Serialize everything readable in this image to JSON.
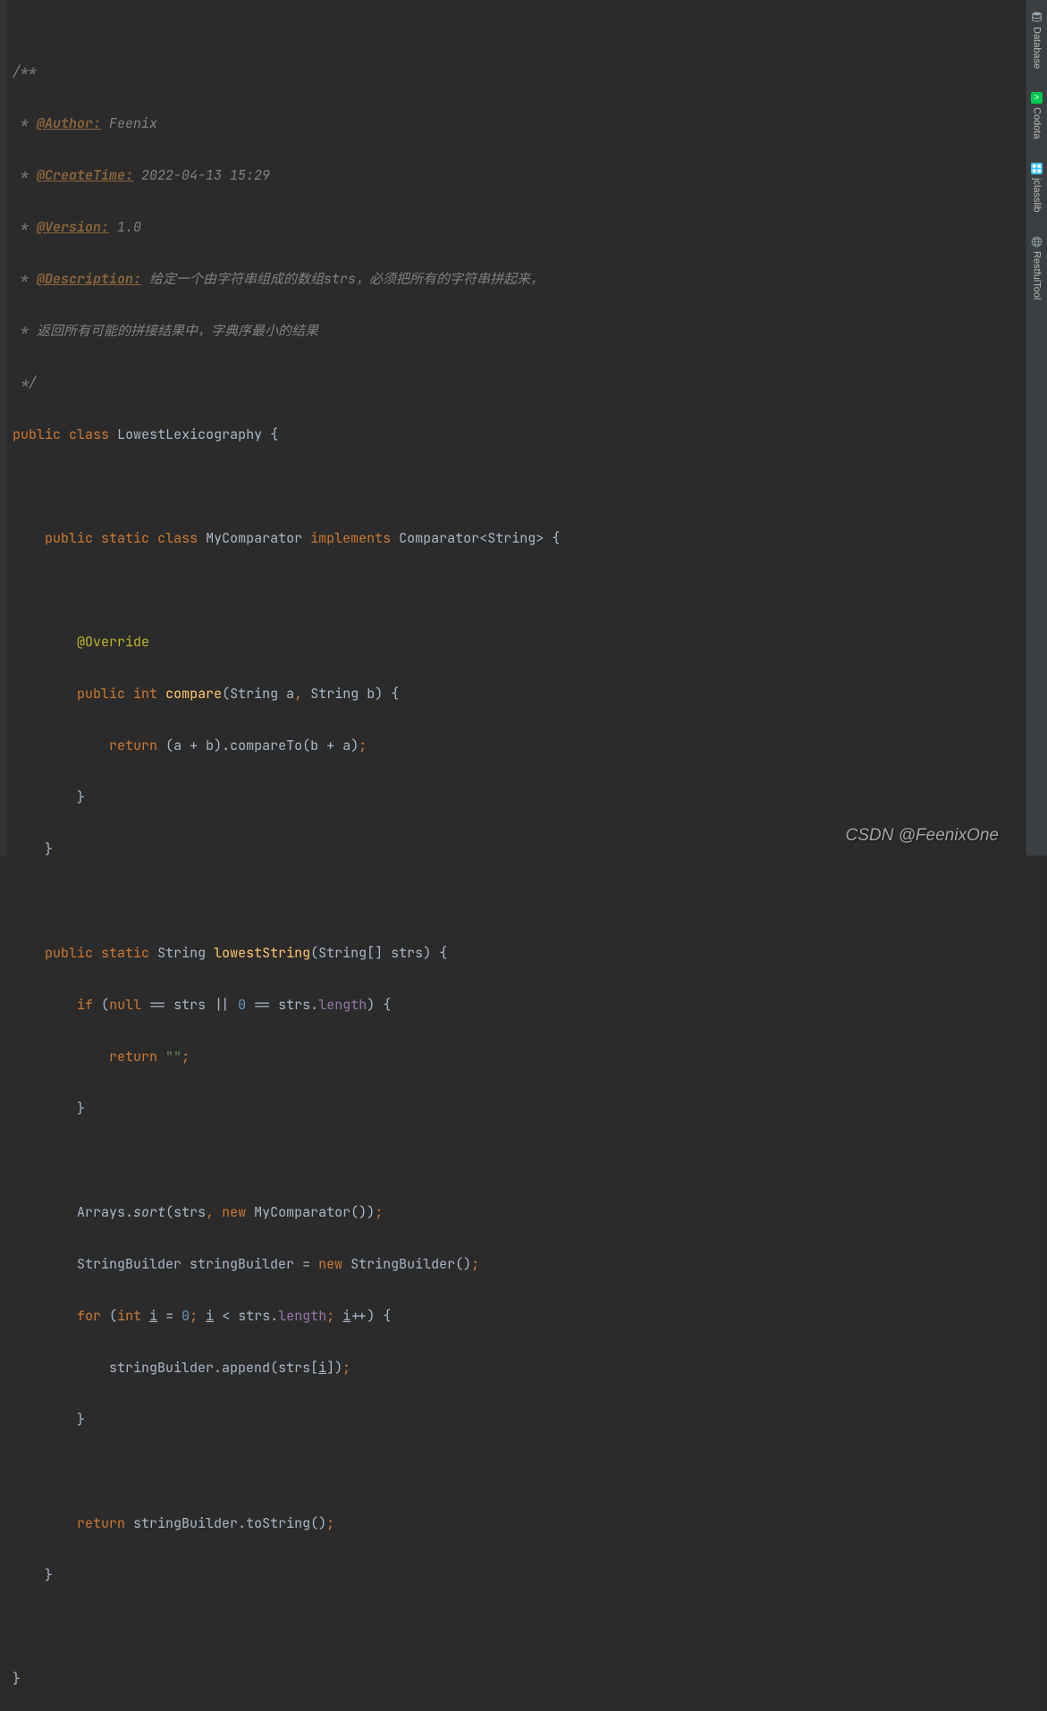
{
  "doc": {
    "author_tag": "@Author:",
    "author": " Feenix",
    "createtime_tag": "@CreateTime:",
    "createtime": " 2022-04-13 15:29",
    "version_tag": "@Version:",
    "version": " 1.0",
    "description_tag": "@Description:",
    "description": " 给定一个由字符串组成的数组strs，必须把所有的字符串拼起来，",
    "description2": " * 返回所有可能的拼接结果中，字典序最小的结果"
  },
  "code": {
    "public": "public",
    "class": "class",
    "static": "static",
    "implements": "implements",
    "int": "int",
    "return": "return",
    "if": "if",
    "null": "null",
    "new": "new",
    "for": "for",
    "className": "LowestLexicography",
    "innerClass": "MyComparator",
    "comparator": "Comparator",
    "string": "String",
    "override": "@Override",
    "compare": "compare",
    "lowestString": "lowestString",
    "compareTo": "compareTo",
    "length": "length",
    "arrays": "Arrays",
    "sort": "sort",
    "sb": "StringBuilder",
    "sbVar": "stringBuilder",
    "append": "append",
    "toString": "toString",
    "strs": "strs",
    "paramA": "a",
    "paramB": "b",
    "paramI": "i",
    "zero": "0",
    "empty": "\"\"",
    "plus": " + ",
    "eq": " == ",
    "or": " || ",
    "assign": " = ",
    "lt": " < ",
    "inc": "++"
  },
  "sidebar": {
    "database": "Database",
    "codota": "Codota",
    "jclasslib": "jclasslib",
    "rest": "RestfulTool"
  },
  "watermark": "CSDN @FeenixOne"
}
